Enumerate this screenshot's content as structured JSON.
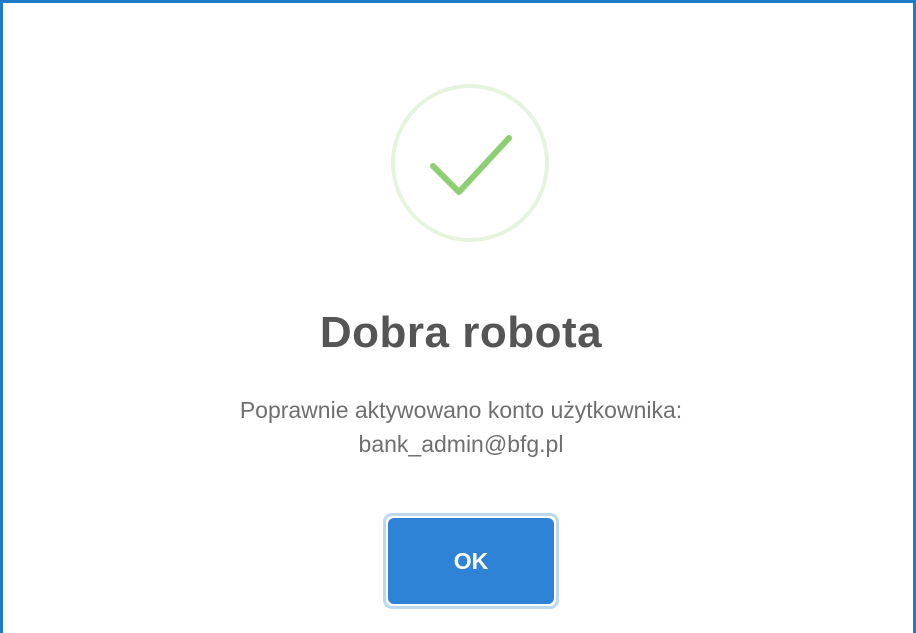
{
  "dialog": {
    "icon": "check-icon",
    "colors": {
      "border": "#1e7bc6",
      "check": "#8fcf73",
      "check_ring": "#e6f4de",
      "title": "#555555",
      "message": "#6f6f6f",
      "button": "#2f83d6",
      "button_focus_ring": "#bcd8ef"
    },
    "title": "Dobra robota",
    "message_line1": "Poprawnie aktywowano konto użytkownika:",
    "message_line2": "bank_admin@bfg.pl",
    "ok_label": "OK"
  }
}
